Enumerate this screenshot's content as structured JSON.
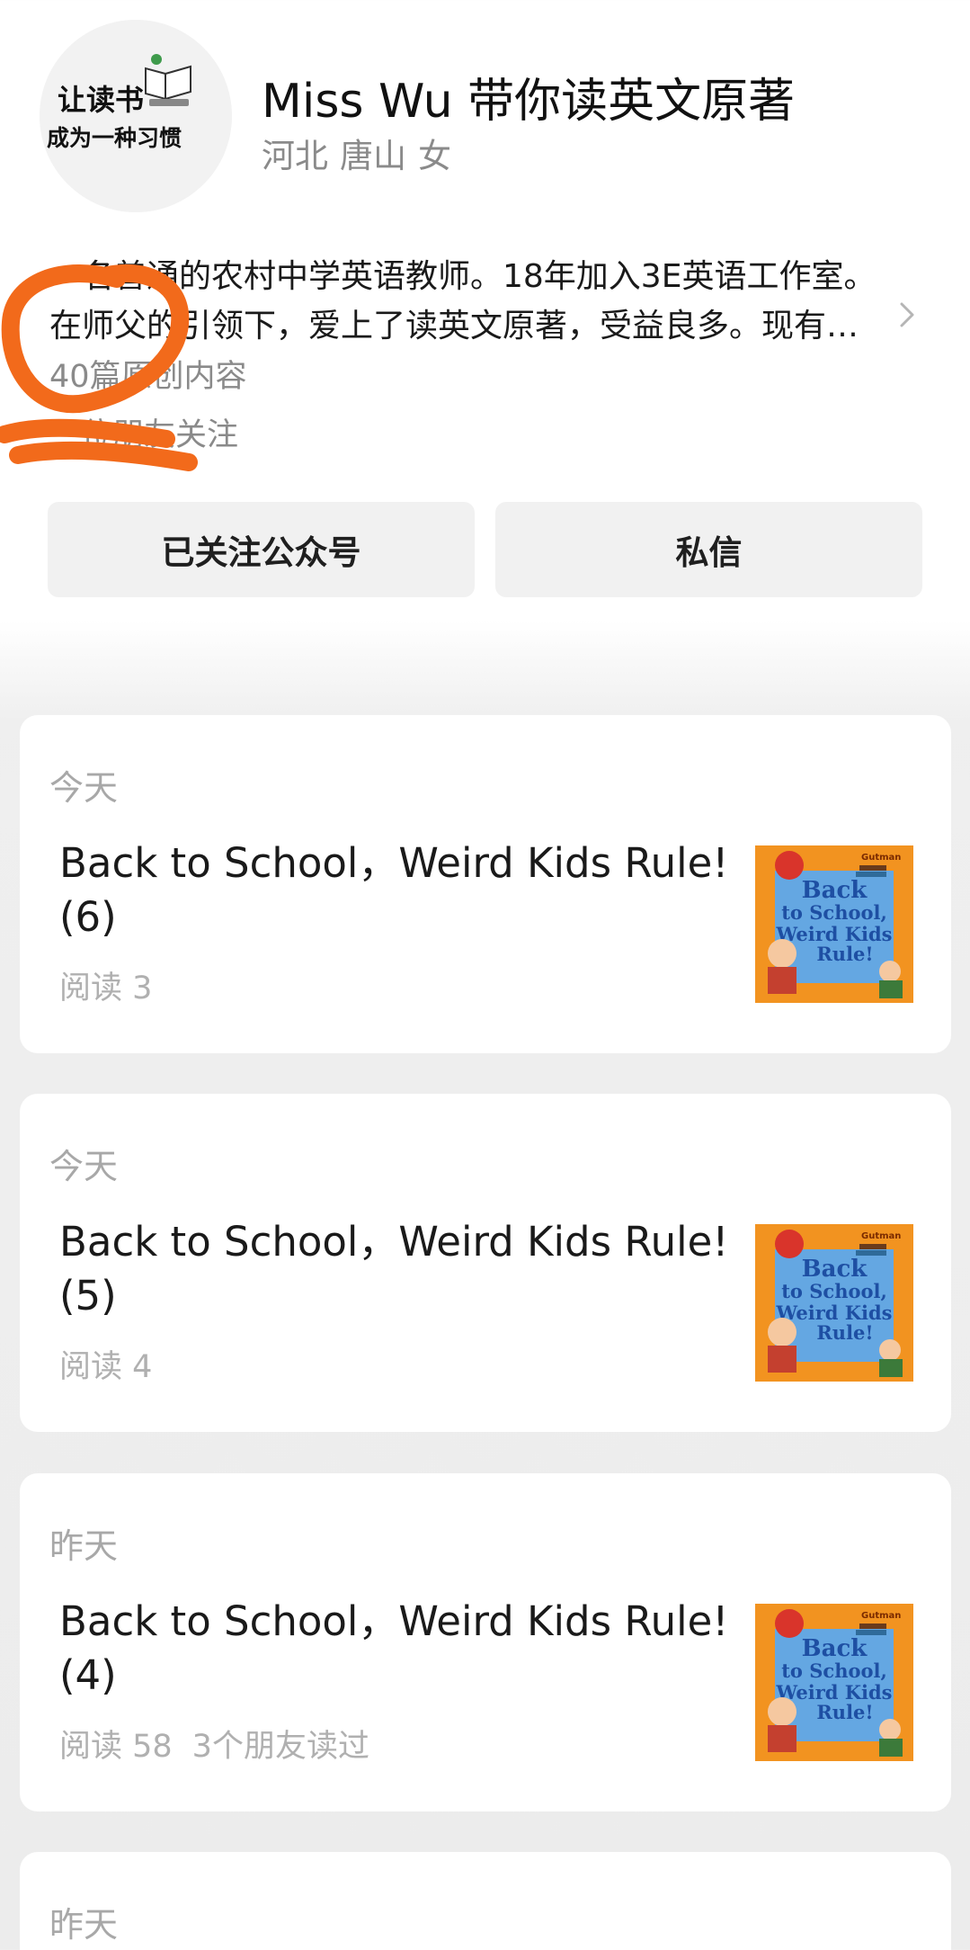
{
  "profile": {
    "avatar_text_line1": "让读书",
    "avatar_text_line2": "成为一种习惯",
    "name": "Miss Wu 带你读英文原著",
    "region": "河北",
    "city": "唐山",
    "gender": "女",
    "bio_line1": "一名普通的农村中学英语教师。18年加入3E英语工作室。",
    "bio_line2": "在师父的引领下，爱上了读英文原著，受益良多。现有…",
    "articles_count": "40篇原创内容",
    "follow_status": "位朋友关注",
    "follow_button": "已关注公众号",
    "message_button": "私信"
  },
  "thumbnail": {
    "author": "Gutman",
    "title_line1": "Back",
    "title_line2": "to School,",
    "title_line3": "Weird Kids",
    "title_line4": "Rule!"
  },
  "articles": [
    {
      "date": "今天",
      "title": "Back to School，Weird Kids Rule!(6)",
      "reads": "阅读 3",
      "friends": ""
    },
    {
      "date": "今天",
      "title": "Back to School，Weird Kids Rule!(5)",
      "reads": "阅读 4",
      "friends": ""
    },
    {
      "date": "昨天",
      "title": "Back to School，Weird Kids Rule!(4)",
      "reads": "阅读 58",
      "friends": "3个朋友读过"
    },
    {
      "date": "昨天",
      "title": "",
      "reads": "",
      "friends": ""
    }
  ],
  "colors": {
    "scribble": "#f26a1b",
    "button_bg": "#f1f1f1",
    "book_orange": "#f29320",
    "book_blue": "#4a8fd6"
  }
}
